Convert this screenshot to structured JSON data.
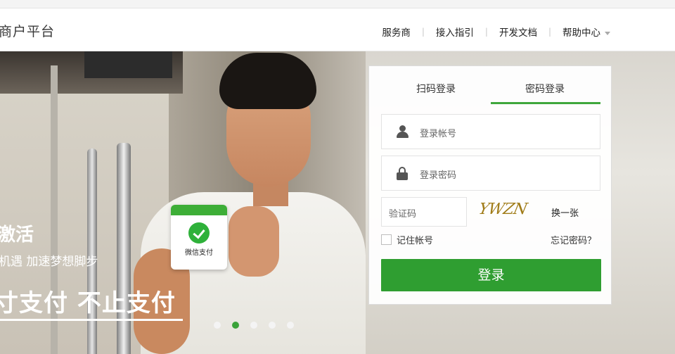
{
  "header": {
    "brand": "商户平台",
    "nav": [
      {
        "label": "服务商"
      },
      {
        "label": "接入指引"
      },
      {
        "label": "开发文档"
      },
      {
        "label": "帮助中心"
      }
    ]
  },
  "banner": {
    "card_label": "微信支付",
    "slogan_line1": "激活",
    "slogan_line2": "机遇 加速梦想脚步",
    "slogan_line3": "寸支付 不止支付",
    "slides_count": 5,
    "active_slide": 2
  },
  "login": {
    "tabs": [
      {
        "label": "扫码登录",
        "active": false
      },
      {
        "label": "密码登录",
        "active": true
      }
    ],
    "username_placeholder": "登录帐号",
    "password_placeholder": "登录密码",
    "captcha_placeholder": "验证码",
    "captcha_text": "YWZN",
    "refresh_label": "换一张",
    "remember_label": "记住帐号",
    "remember_checked": false,
    "forgot_label": "忘记密码？",
    "submit_label": "登录"
  },
  "colors": {
    "accent": "#2f9e31",
    "tab_underline": "#3fa73c",
    "active_dot": "#3aa33a"
  }
}
